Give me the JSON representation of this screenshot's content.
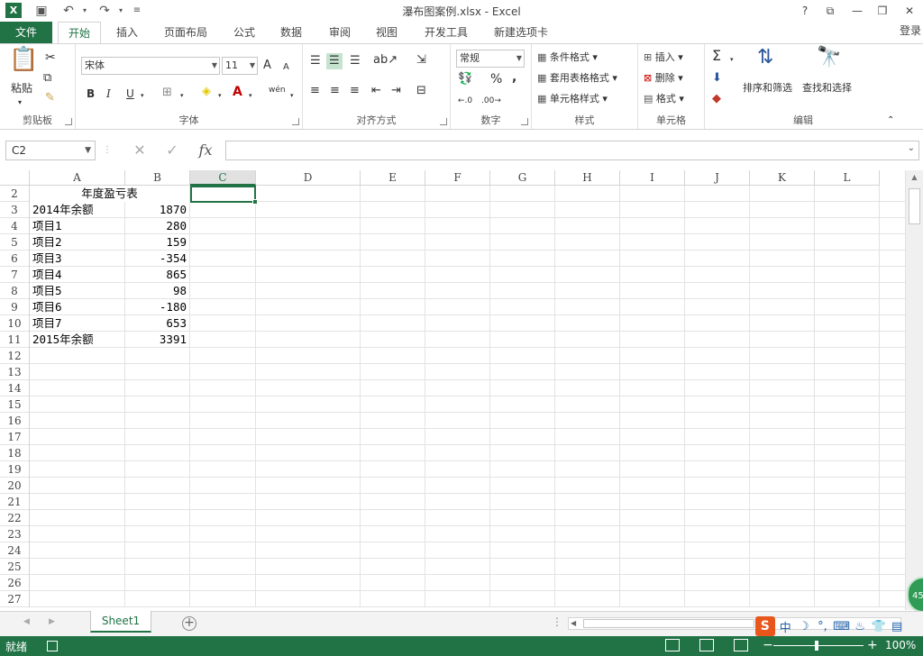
{
  "window": {
    "title": "瀑布图案例.xlsx - Excel",
    "app_logo": "X",
    "controls": [
      "?",
      "⧉",
      "—",
      "❐",
      "✕"
    ]
  },
  "quick_access": {
    "icons": [
      "save-icon",
      "undo-icon",
      "redo-icon",
      "customize-icon"
    ]
  },
  "tabs": {
    "file": "文件",
    "items": [
      "开始",
      "插入",
      "页面布局",
      "公式",
      "数据",
      "审阅",
      "视图",
      "开发工具",
      "新建选项卡"
    ],
    "active": "开始",
    "login": "登录"
  },
  "ribbon": {
    "clipboard": {
      "label": "剪贴板",
      "paste": "粘贴"
    },
    "font": {
      "label": "字体",
      "name": "宋体",
      "size": "11",
      "bold": "B",
      "italic": "I",
      "underline": "U",
      "grow": "A",
      "shrink": "A",
      "color_a": "A",
      "wen": "wén"
    },
    "align": {
      "label": "对齐方式"
    },
    "number": {
      "label": "数字",
      "format": "常规",
      "percent": "%",
      "comma": ","
    },
    "styles": {
      "label": "样式",
      "cond": "条件格式",
      "table": "套用表格格式",
      "cell": "单元格样式"
    },
    "cells": {
      "label": "单元格",
      "insert": "插入",
      "delete": "删除",
      "format": "格式"
    },
    "edit": {
      "label": "编辑",
      "sort": "排序和筛选",
      "find": "查找和选择"
    }
  },
  "formula_bar": {
    "name_box": "C2",
    "fx": "fx",
    "value": ""
  },
  "grid": {
    "columns": [
      "A",
      "B",
      "C",
      "D",
      "E",
      "F",
      "G",
      "H",
      "I",
      "J",
      "K",
      "L"
    ],
    "selected_column": "C",
    "row_numbers": [
      "2",
      "3",
      "4",
      "5",
      "6",
      "7",
      "8",
      "9",
      "10",
      "11",
      "12",
      "13",
      "14",
      "15",
      "16",
      "17",
      "18",
      "19",
      "20",
      "21",
      "22",
      "23",
      "24",
      "25",
      "26",
      "27"
    ],
    "header_merged": "年度盈亏表",
    "rows": [
      {
        "label": "2014年余额",
        "value": "1870"
      },
      {
        "label": "项目1",
        "value": "280"
      },
      {
        "label": "项目2",
        "value": "159"
      },
      {
        "label": "项目3",
        "value": "-354"
      },
      {
        "label": "项目4",
        "value": "865"
      },
      {
        "label": "项目5",
        "value": "98"
      },
      {
        "label": "项目6",
        "value": "-180"
      },
      {
        "label": "项目7",
        "value": "653"
      },
      {
        "label": "2015年余额",
        "value": "3391"
      }
    ],
    "selected_cell": "C2"
  },
  "sheets": {
    "items": [
      "Sheet1"
    ],
    "active": "Sheet1"
  },
  "ime": {
    "logo": "S",
    "mode": "中",
    "glyphs": [
      "☽",
      "°,",
      "⌨",
      "♨",
      "👕",
      "▤"
    ]
  },
  "status": {
    "ready": "就绪",
    "zoom": "100%",
    "minus": "−",
    "plus": "+"
  },
  "badge": {
    "text": "45"
  }
}
